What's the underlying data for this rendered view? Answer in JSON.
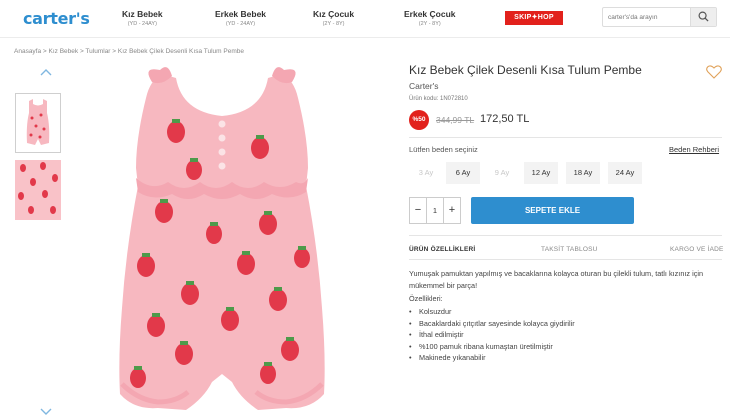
{
  "header": {
    "logo": "carter's",
    "nav": [
      {
        "label": "Kız Bebek",
        "sub": "(YD - 24AY)"
      },
      {
        "label": "Erkek Bebek",
        "sub": "(YD - 24AY)"
      },
      {
        "label": "Kız Çocuk",
        "sub": "(2Y - 8Y)"
      },
      {
        "label": "Erkek Çocuk",
        "sub": "(2Y - 8Y)"
      }
    ],
    "skip_hop": "SKIP✦HOP",
    "search_placeholder": "carter's'da arayın"
  },
  "breadcrumb": "Anasayfa > Kız Bebek > Tulumlar > Kız Bebek Çilek Desenli Kısa Tulum Pembe",
  "product": {
    "title": "Kız Bebek Çilek Desenli Kısa Tulum Pembe",
    "brand": "Carter's",
    "code": "Ürün kodu: 1N072810",
    "discount": "%50",
    "old_price": "344,99 TL",
    "new_price": "172,50 TL",
    "size_label": "Lütfen beden seçiniz",
    "size_guide": "Beden Rehberi",
    "sizes": [
      {
        "label": "3 Ay",
        "available": false
      },
      {
        "label": "6 Ay",
        "available": true
      },
      {
        "label": "9 Ay",
        "available": false
      },
      {
        "label": "12 Ay",
        "available": true
      },
      {
        "label": "18 Ay",
        "available": true
      },
      {
        "label": "24 Ay",
        "available": true
      }
    ],
    "quantity": "1",
    "add_to_cart": "SEPETE EKLE",
    "tabs": [
      "ÜRÜN ÖZELLİKLERİ",
      "TAKSİT TABLOSU",
      "KARGO VE İADE"
    ],
    "description": "Yumuşak pamuktan yapılmış ve bacaklarına kolayca oturan bu çilekli tulum, tatlı kızınız için mükemmel bir parça!",
    "features_title": "Özellikleri:",
    "features": [
      "Kolsuzdur",
      "Bacaklardaki çıtçıtlar sayesinde kolayca giydirilir",
      "İthal edilmiştir",
      "%100 pamuk ribana kumaştan üretilmiştir",
      "Makinede yıkanabilir"
    ]
  },
  "colors": {
    "brand_blue": "#2e8ecf",
    "sale_red": "#e2211c",
    "garment_pink": "#f7b8c0",
    "strawberry_red": "#e2394a"
  }
}
